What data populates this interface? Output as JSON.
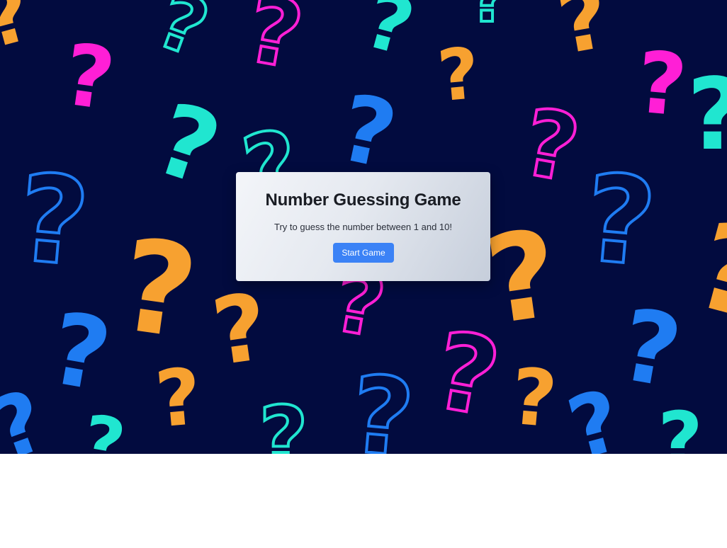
{
  "game": {
    "title": "Number Guessing Game",
    "instructions": "Try to guess the number between 1 and 10!",
    "start_button_label": "Start Game"
  },
  "theme": {
    "background": "#020b3f",
    "accent_button": "#3b82f6",
    "question_mark_colors": [
      "#f7a130",
      "#ff1fd6",
      "#20e6d0",
      "#1f7cf2"
    ]
  },
  "background_pattern": {
    "icon": "question-mark-icon",
    "glyph": "?"
  }
}
